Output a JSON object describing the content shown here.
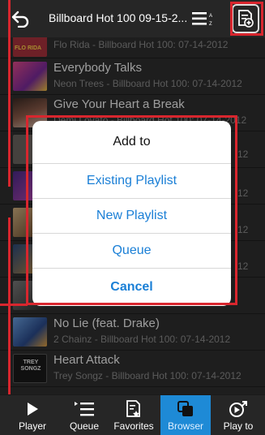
{
  "header": {
    "title": "Billboard Hot 100 09-15-2..."
  },
  "songs": [
    {
      "title": "",
      "subtitle": "Flo Rida - Billboard Hot 100: 07-14-2012",
      "art_color": "#a8323c",
      "art_text": "FLO RIDA"
    },
    {
      "title": "Everybody Talks",
      "subtitle": "Neon Trees - Billboard Hot 100: 07-14-2012",
      "art_color": "#c03a7a"
    },
    {
      "title": "Give Your Heart a Break",
      "subtitle": "Demi Lovato - Billboard Hot 100: 07-14-2012",
      "art_color": "#6b4a3e"
    },
    {
      "title": "",
      "subtitle": "",
      "art_color": "#5a5248"
    },
    {
      "title": "",
      "subtitle": "",
      "art_color": "#7a3a8a"
    },
    {
      "title": "",
      "subtitle": "",
      "art_color": "#c2a070"
    },
    {
      "title": "",
      "subtitle": "",
      "art_color": "#3a5a8a"
    },
    {
      "title": "",
      "subtitle": "",
      "art_color": "#5a5a5a"
    },
    {
      "title": "No Lie (feat. Drake)",
      "subtitle": "2 Chainz - Billboard Hot 100: 07-14-2012",
      "art_color": "#4a6ab0"
    },
    {
      "title": "Heart Attack",
      "subtitle": "Trey Songz - Billboard Hot 100: 07-14-2012",
      "art_color": "#1c1c1c",
      "art_text": "TREY SONGZ"
    }
  ],
  "partial_subs": [
    "12",
    "12",
    "12",
    "12"
  ],
  "dialog": {
    "title": "Add to",
    "options": [
      "Existing Playlist",
      "New Playlist",
      "Queue"
    ],
    "cancel": "Cancel"
  },
  "nav": {
    "items": [
      {
        "label": "Player",
        "icon": "play-icon"
      },
      {
        "label": "Queue",
        "icon": "queue-icon"
      },
      {
        "label": "Favorites",
        "icon": "favorites-icon"
      },
      {
        "label": "Browser",
        "icon": "browser-icon",
        "active": true
      },
      {
        "label": "Play to",
        "icon": "play-to-icon"
      }
    ]
  },
  "colors": {
    "accent": "#1e8ad6",
    "highlight": "#d8262e",
    "link": "#1a7fd6"
  }
}
